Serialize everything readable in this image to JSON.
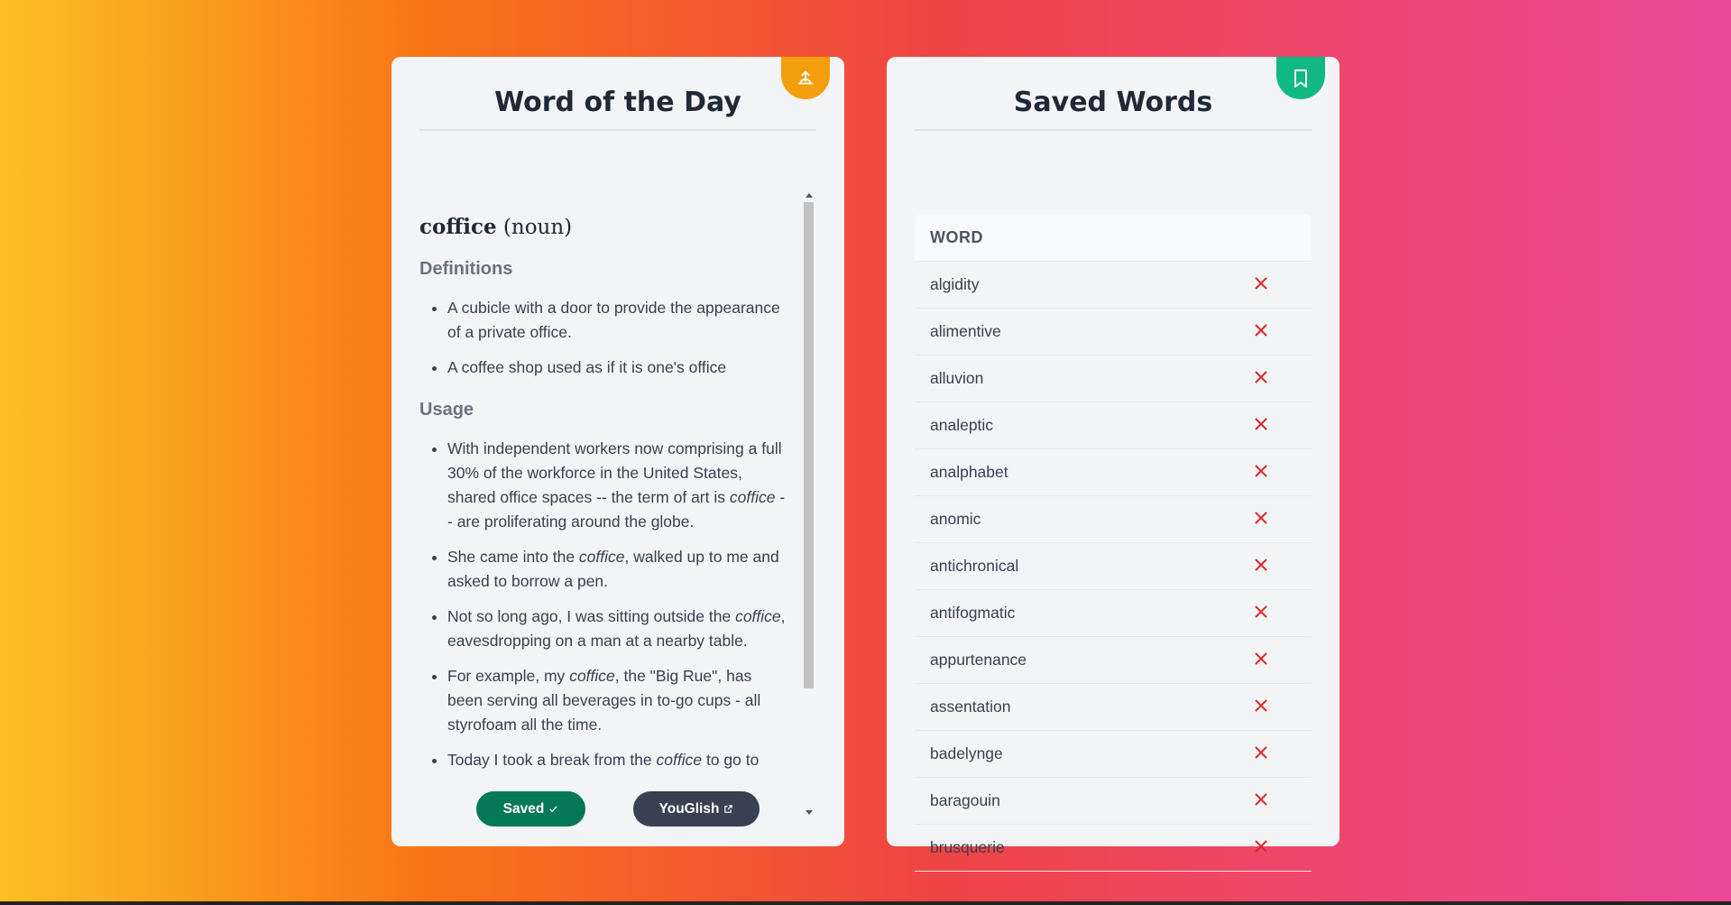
{
  "word_of_the_day": {
    "title": "Word of the Day",
    "corner_icon": "share-upload-icon",
    "word": "coffice",
    "part_of_speech": "(noun)",
    "definitions_heading": "Definitions",
    "definitions": [
      "A cubicle with a door to provide the appearance of a private office.",
      "A coffee shop used as if it is one's office"
    ],
    "usage_heading": "Usage",
    "usage": [
      {
        "before": "With independent workers now comprising a full 30% of the workforce in the United States, shared office spaces -- the term of art is ",
        "em": "coffice",
        "after": " -- are proliferating around the globe."
      },
      {
        "before": "She came into the ",
        "em": "coffice",
        "after": ", walked up to me and asked to borrow a pen."
      },
      {
        "before": "Not so long ago, I was sitting outside the ",
        "em": "coffice",
        "after": ", eavesdropping on a man at a nearby table."
      },
      {
        "before": "For example, my ",
        "em": "coffice",
        "after": ", the \"Big Rue\", has been serving all beverages in to-go cups - all styrofoam all the time."
      },
      {
        "before": "Today I took a break from the ",
        "em": "coffice",
        "after": " to go to"
      }
    ],
    "saved_button": "Saved",
    "youglish_button": "YouGlish"
  },
  "saved_words": {
    "title": "Saved Words",
    "corner_icon": "bookmark-icon",
    "column_header": "WORD",
    "words": [
      "algidity",
      "alimentive",
      "alluvion",
      "analeptic",
      "analphabet",
      "anomic",
      "antichronical",
      "antifogmatic",
      "appurtenance",
      "assentation",
      "badelynge",
      "baragouin",
      "brusquerie"
    ]
  },
  "colors": {
    "saved_button": "#047857",
    "youglish_button": "#374151",
    "delete_icon": "#dc2626",
    "wotd_badge": "#f59e0b",
    "saved_badge": "#10b981"
  }
}
